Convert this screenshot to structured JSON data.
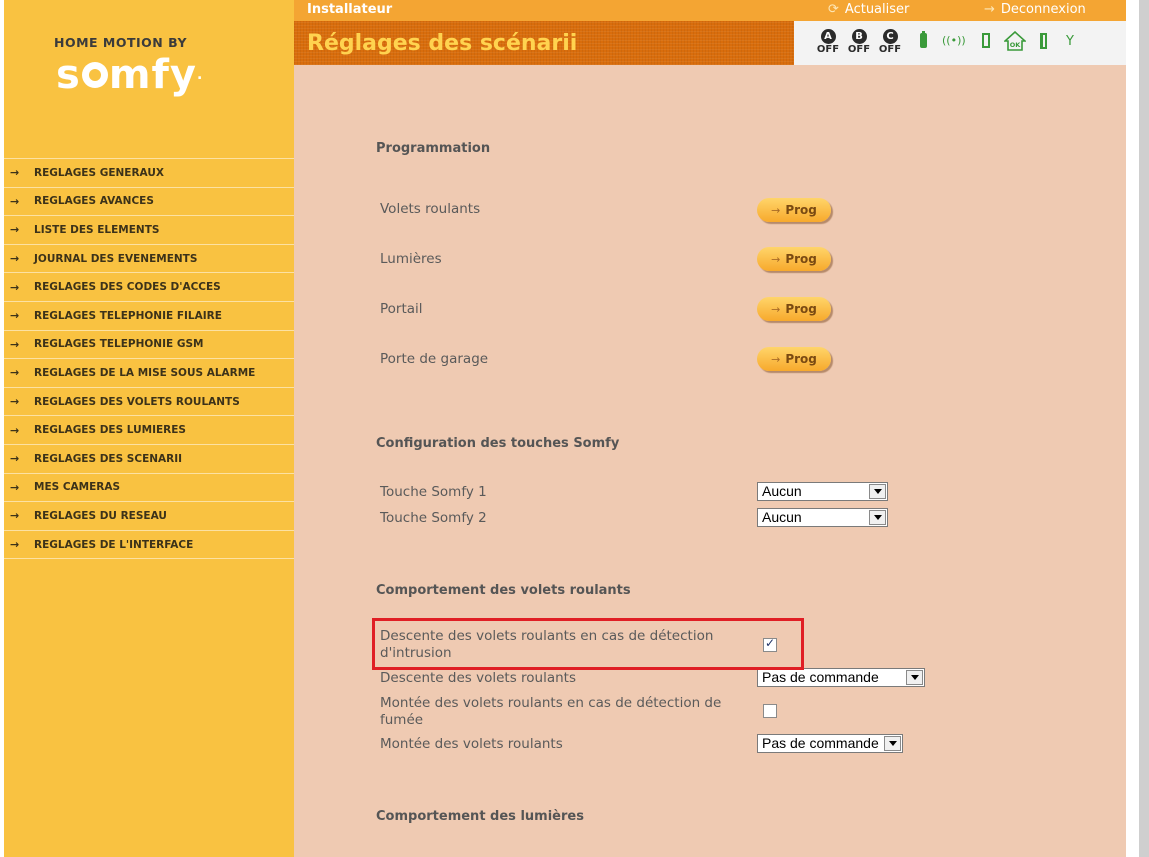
{
  "brand": {
    "top": "HOME MOTION BY",
    "main": "somfy",
    "reg": "."
  },
  "sidebar": {
    "items": [
      {
        "label": "REGLAGES GENERAUX"
      },
      {
        "label": "REGLAGES AVANCES"
      },
      {
        "label": "LISTE DES ELEMENTS"
      },
      {
        "label": "JOURNAL DES EVENEMENTS"
      },
      {
        "label": "REGLAGES DES CODES D'ACCES"
      },
      {
        "label": "REGLAGES TELEPHONIE FILAIRE"
      },
      {
        "label": "REGLAGES TELEPHONIE GSM"
      },
      {
        "label": "REGLAGES DE LA MISE SOUS ALARME"
      },
      {
        "label": "REGLAGES DES VOLETS ROULANTS"
      },
      {
        "label": "REGLAGES DES LUMIERES"
      },
      {
        "label": "REGLAGES DES SCENARII"
      },
      {
        "label": "MES CAMERAS"
      },
      {
        "label": "REGLAGES DU RESEAU"
      },
      {
        "label": "REGLAGES DE L'INTERFACE"
      }
    ]
  },
  "topbar": {
    "title": "Installateur",
    "refresh_label": "Actualiser",
    "logout_label": "Deconnexion"
  },
  "header": {
    "title": "Réglages des scénarii"
  },
  "status": {
    "zones": [
      {
        "letter": "A",
        "state": "OFF"
      },
      {
        "letter": "B",
        "state": "OFF"
      },
      {
        "letter": "C",
        "state": "OFF"
      }
    ],
    "icons": [
      "battery-icon",
      "signal-icon",
      "door-icon",
      "home-ok-icon",
      "window-icon",
      "antenna-icon"
    ],
    "home_ok_text": "OK",
    "signal_text": "((•))",
    "antenna_text": "Y",
    "icon_color": "#3a9a3a"
  },
  "programmation": {
    "heading": "Programmation",
    "button_label": "Prog",
    "rows": [
      {
        "label": "Volets roulants"
      },
      {
        "label": "Lumières"
      },
      {
        "label": "Portail"
      },
      {
        "label": "Porte de garage"
      }
    ]
  },
  "touches": {
    "heading": "Configuration des touches Somfy",
    "rows": [
      {
        "label": "Touche Somfy 1",
        "value": "Aucun"
      },
      {
        "label": "Touche Somfy 2",
        "value": "Aucun"
      }
    ]
  },
  "volets": {
    "heading": "Comportement des volets roulants",
    "intrusion_label": "Descente des volets roulants en cas de détection d'intrusion",
    "intrusion_checked": true,
    "descente_label": "Descente des volets roulants",
    "descente_value": "Pas de commande",
    "fumee_label": "Montée des volets roulants en cas de détection de fumée",
    "fumee_checked": false,
    "montee_label": "Montée des volets roulants",
    "montee_value": "Pas de commande"
  },
  "lumieres": {
    "heading": "Comportement des lumières"
  },
  "colors": {
    "sidebar": "#f9c241",
    "content": "#efcab2",
    "header": "#d96d0c",
    "highlight": "#e01e24",
    "title": "#ffd34f"
  }
}
